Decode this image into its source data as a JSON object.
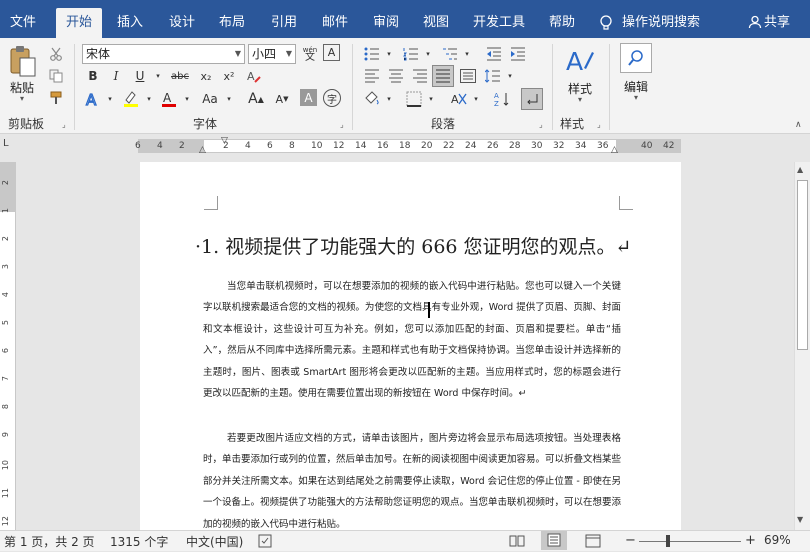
{
  "tabs": [
    "文件",
    "开始",
    "插入",
    "设计",
    "布局",
    "引用",
    "邮件",
    "审阅",
    "视图",
    "开发工具",
    "帮助"
  ],
  "tell_me": "操作说明搜索",
  "share": "共享",
  "ribbon": {
    "paste_label": "粘贴",
    "clipboard_group": "剪贴板",
    "font_group": "字体",
    "paragraph_group": "段落",
    "styles_group": "样式",
    "styles_label": "样式",
    "editing_label": "编辑",
    "font_name": "宋体",
    "font_size": "小四",
    "wen_label": "wén",
    "bold": "B",
    "italic": "I",
    "underline": "U",
    "strike": "abc",
    "subscript": "x₂",
    "superscript": "x²",
    "change_case": "Aa",
    "grow_font": "A",
    "shrink_font": "A",
    "char_shading": "A",
    "enclose": "字",
    "highlight_color": "#ffff00",
    "font_color": "#e00000"
  },
  "ruler_numbers": [
    "6",
    "4",
    "2",
    "",
    "2",
    "4",
    "6",
    "8",
    "10",
    "12",
    "14",
    "16",
    "18",
    "20",
    "22",
    "24",
    "26",
    "28",
    "30",
    "32",
    "34",
    "36",
    "",
    "40",
    "42"
  ],
  "vruler_numbers": [
    "2",
    "1",
    "2",
    "3",
    "4",
    "5",
    "6",
    "7",
    "8",
    "9",
    "10",
    "11",
    "12"
  ],
  "document": {
    "heading": "·1. 视频提供了功能强大的 666 您证明您的观点。↵",
    "paragraph1": "当您单击联机视频时，可以在想要添加的视频的嵌入代码中进行粘贴。您也可以键入一个关键字以联机搜索最适合您的文档的视频。为使您的文档具有专业外观，Word 提供了页眉、页脚、封面和文本框设计，这些设计可互为补充。例如，您可以添加匹配的封面、页眉和提要栏。单击“插入”，然后从不同库中选择所需元素。主题和样式也有助于文档保持协调。当您单击设计并选择新的主题时，图片、图表或 SmartArt 图形将会更改以匹配新的主题。当应用样式时，您的标题会进行更改以匹配新的主题。使用在需要位置出现的新按钮在 Word 中保存时间。↵",
    "paragraph2": "若要更改图片适应文档的方式，请单击该图片，图片旁边将会显示布局选项按钮。当处理表格时，单击要添加行或列的位置，然后单击加号。在新的阅读视图中阅读更加容易。可以折叠文档某些部分并关注所需文本。如果在达到结尾处之前需要停止读取，Word 会记住您的停止位置 - 即使在另一个设备上。视频提供了功能强大的方法帮助您证明您的观点。当您单击联机视频时，可以在想要添加的视频的嵌入代码中进行粘贴。"
  },
  "status": {
    "page": "第 1 页，共 2 页",
    "words": "1315 个字",
    "language": "中文(中国)",
    "zoom": "69%",
    "zoom_minus": "−",
    "zoom_plus": "+",
    "zoom_level": 0.69
  }
}
